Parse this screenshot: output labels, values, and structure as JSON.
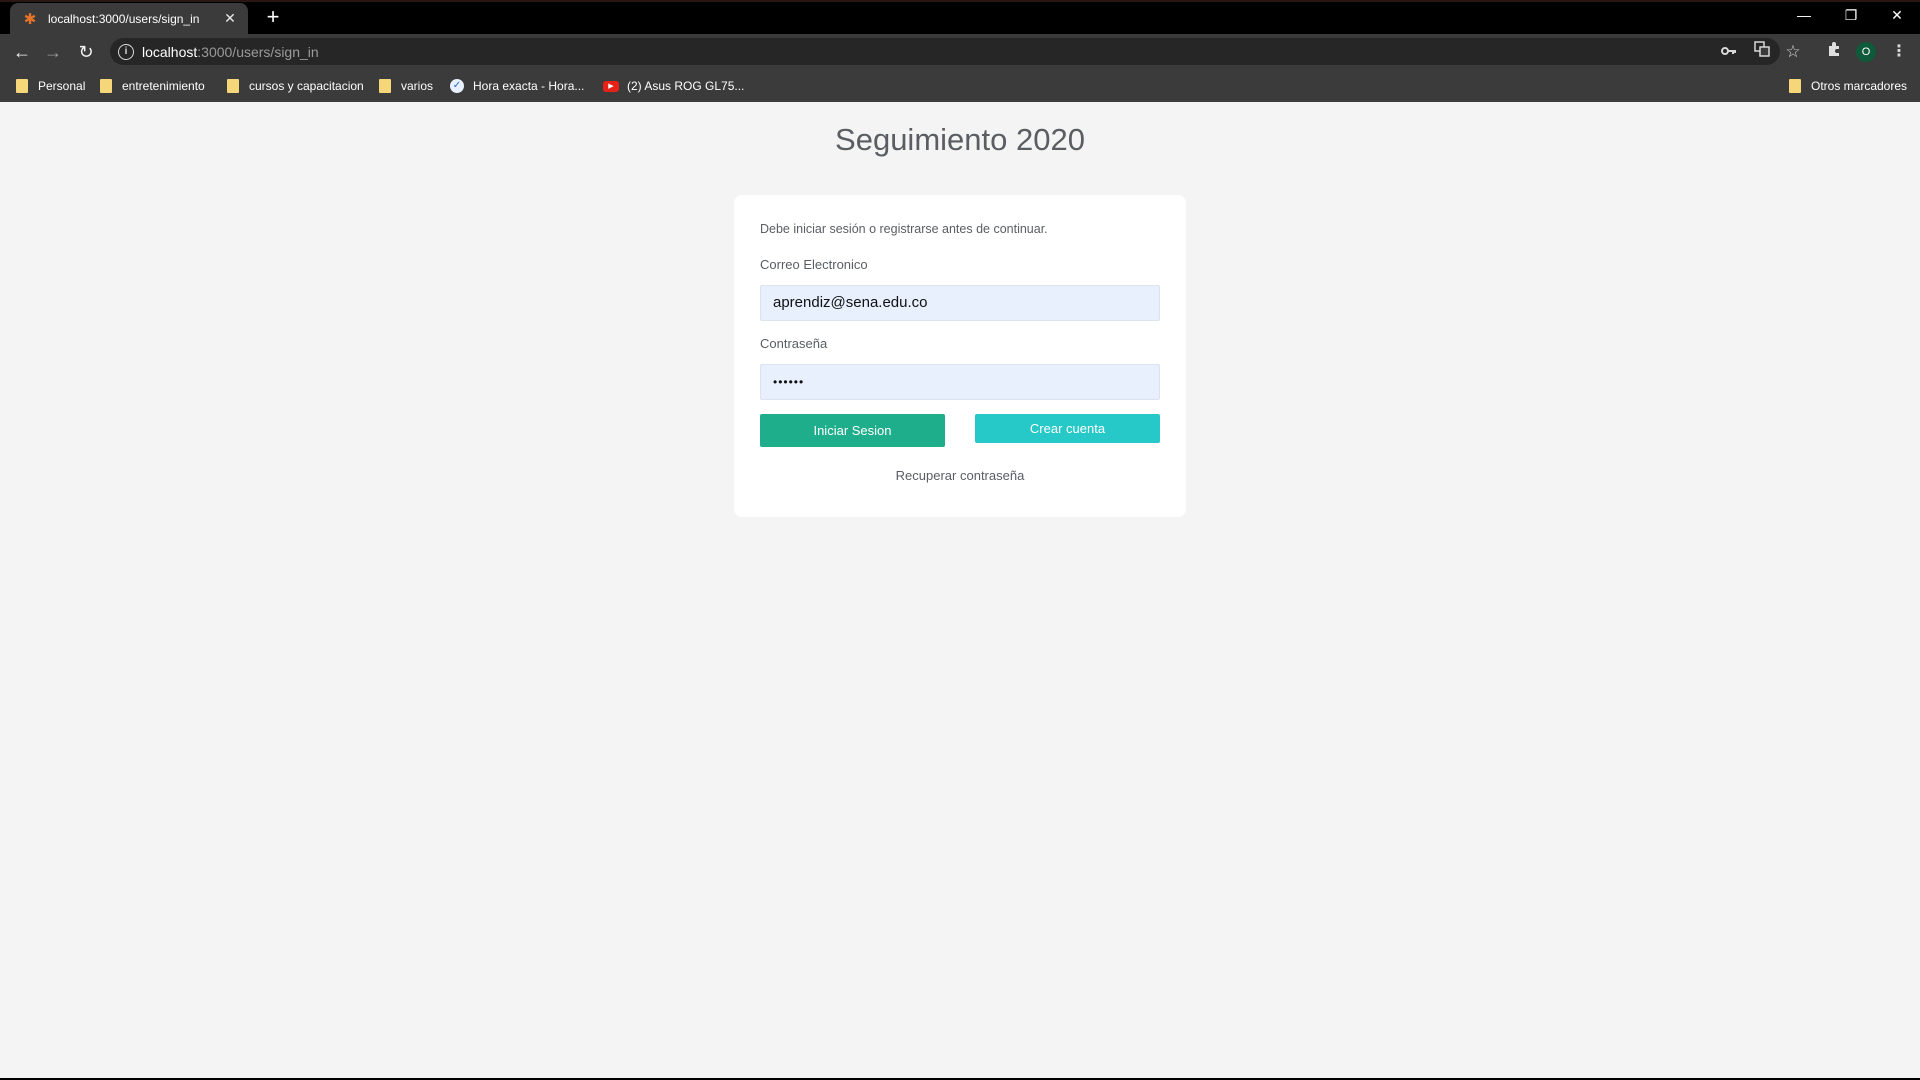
{
  "browser": {
    "tab": {
      "title": "localhost:3000/users/sign_in",
      "favicon": "sena-logo-icon",
      "close_glyph": "✕"
    },
    "new_tab_glyph": "+",
    "window_controls": {
      "minimize": "—",
      "restore": "❐",
      "close": "✕"
    },
    "toolbar": {
      "back_glyph": "←",
      "forward_glyph": "→",
      "reload_glyph": "↻",
      "url_host": "localhost",
      "url_path": ":3000/users/sign_in",
      "icons": [
        "key-icon",
        "translate-icon",
        "star-icon",
        "extensions-icon",
        "menu-icon"
      ],
      "profile_initial": "O"
    },
    "bookmarks": [
      {
        "label": "Personal",
        "icon": "folder"
      },
      {
        "label": "entretenimiento",
        "icon": "folder"
      },
      {
        "label": "cursos y capacitacion",
        "icon": "folder"
      },
      {
        "label": "varios",
        "icon": "folder"
      },
      {
        "label": "Hora exacta - Hora...",
        "icon": "check-circle"
      },
      {
        "label": "(2) Asus ROG GL75...",
        "icon": "youtube"
      }
    ],
    "other_bookmarks": "Otros marcadores"
  },
  "page": {
    "title": "Seguimiento 2020",
    "notice": "Debe iniciar sesión o registrarse antes de continuar.",
    "email_label": "Correo Electronico",
    "email_value": "aprendiz@sena.edu.co",
    "password_label": "Contraseña",
    "password_value": "••••••",
    "login_button": "Iniciar Sesion",
    "create_button": "Crear cuenta",
    "recover_link": "Recuperar contraseña"
  },
  "colors": {
    "login_button": "#1fae8b",
    "create_button": "#27c8c8",
    "input_background": "#e8f0fe",
    "page_background": "#f4f4f4"
  }
}
